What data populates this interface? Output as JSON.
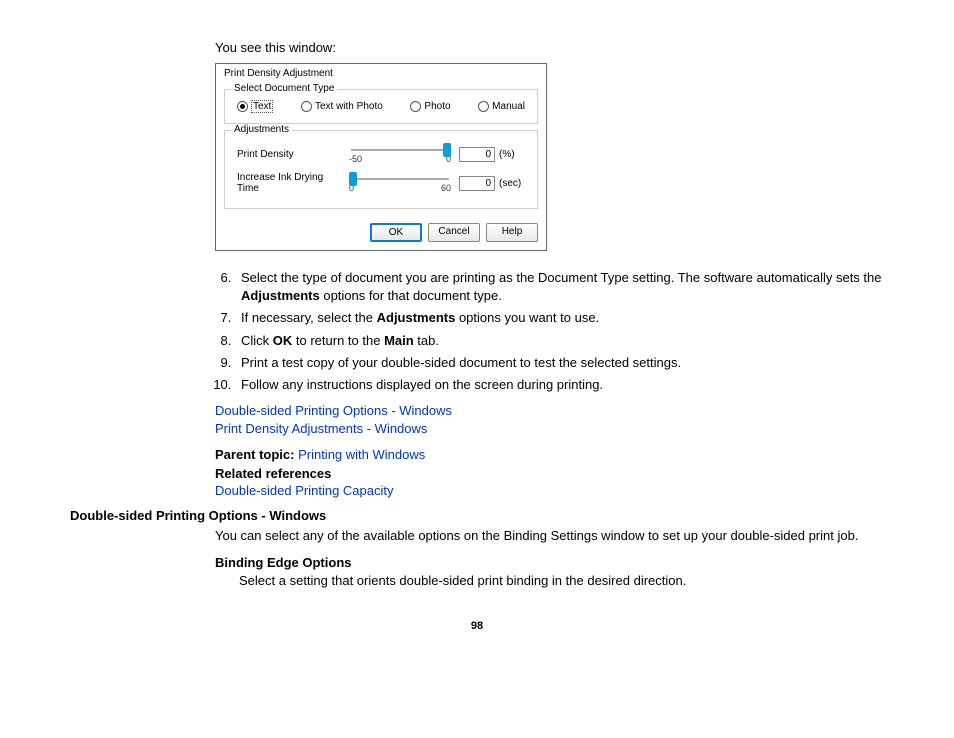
{
  "intro_text": "You see this window:",
  "dialog": {
    "title": "Print Density Adjustment",
    "group1_title": "Select Document Type",
    "radios": {
      "text": "Text",
      "text_photo": "Text with Photo",
      "photo": "Photo",
      "manual": "Manual"
    },
    "group2_title": "Adjustments",
    "slider1": {
      "label": "Print Density",
      "tick_min": "-50",
      "tick_max": "0",
      "value": "0",
      "unit": "(%)"
    },
    "slider2": {
      "label": "Increase Ink Drying Time",
      "tick_min": "0",
      "tick_max": "60",
      "value": "0",
      "unit": "(sec)"
    },
    "buttons": {
      "ok": "OK",
      "cancel": "Cancel",
      "help": "Help"
    }
  },
  "steps": {
    "s6a": "Select the type of document you are printing as the Document Type setting. The software automatically sets the ",
    "s6b": "Adjustments",
    "s6c": " options for that document type.",
    "s7a": "If necessary, select the ",
    "s7b": "Adjustments",
    "s7c": " options you want to use.",
    "s8a": "Click ",
    "s8b": "OK",
    "s8c": " to return to the ",
    "s8d": "Main",
    "s8e": " tab.",
    "s9": "Print a test copy of your double-sided document to test the selected settings.",
    "s10": "Follow any instructions displayed on the screen during printing."
  },
  "links": {
    "l1": "Double-sided Printing Options - Windows",
    "l2": "Print Density Adjustments - Windows",
    "parent_label": "Parent topic: ",
    "parent_link": "Printing with Windows",
    "related_label": "Related references",
    "related_link": "Double-sided Printing Capacity"
  },
  "section": {
    "heading": "Double-sided Printing Options - Windows",
    "body": "You can select any of the available options on the Binding Settings window to set up your double-sided print job.",
    "sub_heading": "Binding Edge Options",
    "sub_body": "Select a setting that orients double-sided print binding in the desired direction."
  },
  "page_number": "98"
}
